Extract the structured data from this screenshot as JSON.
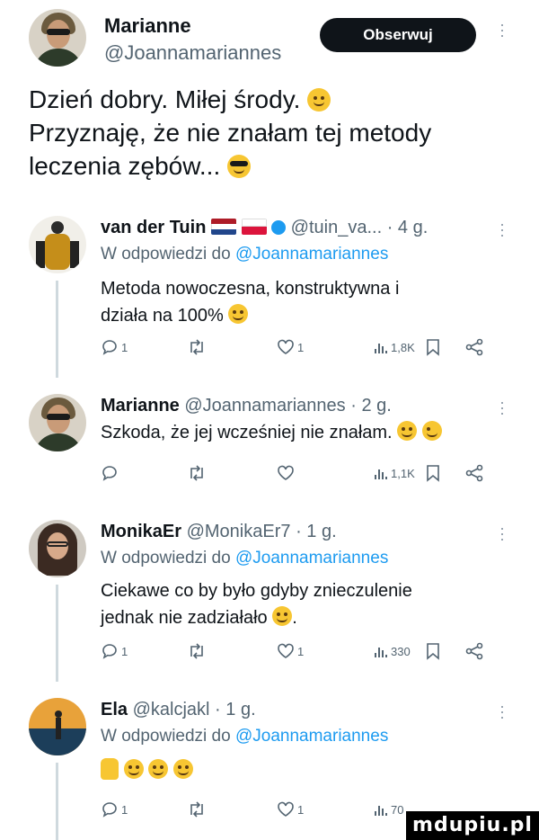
{
  "header": {
    "name": "Marianne",
    "handle": "@Joannamariannes",
    "follow_label": "Obserwuj"
  },
  "post": {
    "line1": "Dzień dobry. Miłej środy.",
    "line2": "Przyznaję, że nie znałam tej metody",
    "line3": "leczenia zębów..."
  },
  "replies": [
    {
      "name": "van der Tuin",
      "handle": "@tuin_va...",
      "time": "· 4 g.",
      "reply_prefix": "W odpowiedzi do",
      "reply_to": "@Joannamariannes",
      "text_line1": "Metoda nowoczesna, konstruktywna i",
      "text_line2": "działa na 100%",
      "reply_count": "1",
      "like_count": "1",
      "views": "1,8K"
    },
    {
      "name": "Marianne",
      "handle": "@Joannamariannes",
      "time": "· 2 g.",
      "text_line1": "Szkoda, że jej wcześniej nie znałam.",
      "views": "1,1K"
    },
    {
      "name": "MonikaEr",
      "handle": "@MonikaEr7",
      "time": "· 1 g.",
      "reply_prefix": "W odpowiedzi do",
      "reply_to": "@Joannamariannes",
      "text_line1": "Ciekawe co by było gdyby znieczulenie",
      "text_line2": "jednak nie zadziałało",
      "reply_count": "1",
      "like_count": "1",
      "views": "330"
    },
    {
      "name": "Ela",
      "handle": "@kalcjakl",
      "time": "· 1 g.",
      "reply_prefix": "W odpowiedzi do",
      "reply_to": "@Joannamariannes",
      "reply_count": "1",
      "like_count": "1",
      "views": "70"
    }
  ],
  "watermark": "mdupiu.pl",
  "colors": {
    "text": "#0f1419",
    "muted": "#536471",
    "link": "#1d9bf0",
    "button_bg": "#0f1419",
    "emoji": "#f7c632"
  }
}
